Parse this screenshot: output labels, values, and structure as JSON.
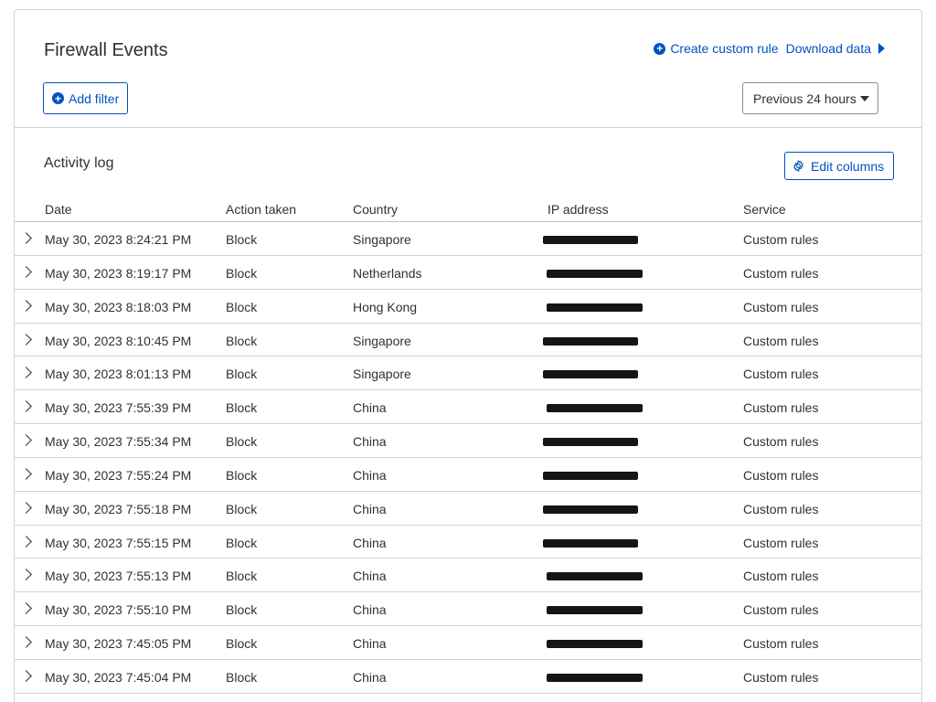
{
  "header": {
    "title": "Firewall Events",
    "create_rule_label": "Create custom rule",
    "download_label": "Download data",
    "add_filter_label": "Add filter",
    "time_range": "Previous 24 hours"
  },
  "activity": {
    "title": "Activity log",
    "edit_columns_label": "Edit columns",
    "columns": [
      "Date",
      "Action taken",
      "Country",
      "IP address",
      "Service"
    ],
    "rows": [
      {
        "date": "May 30, 2023 8:24:21 PM",
        "action": "Block",
        "country": "Singapore",
        "service": "Custom rules"
      },
      {
        "date": "May 30, 2023 8:19:17 PM",
        "action": "Block",
        "country": "Netherlands",
        "service": "Custom rules"
      },
      {
        "date": "May 30, 2023 8:18:03 PM",
        "action": "Block",
        "country": "Hong Kong",
        "service": "Custom rules"
      },
      {
        "date": "May 30, 2023 8:10:45 PM",
        "action": "Block",
        "country": "Singapore",
        "service": "Custom rules"
      },
      {
        "date": "May 30, 2023 8:01:13 PM",
        "action": "Block",
        "country": "Singapore",
        "service": "Custom rules"
      },
      {
        "date": "May 30, 2023 7:55:39 PM",
        "action": "Block",
        "country": "China",
        "service": "Custom rules"
      },
      {
        "date": "May 30, 2023 7:55:34 PM",
        "action": "Block",
        "country": "China",
        "service": "Custom rules"
      },
      {
        "date": "May 30, 2023 7:55:24 PM",
        "action": "Block",
        "country": "China",
        "service": "Custom rules"
      },
      {
        "date": "May 30, 2023 7:55:18 PM",
        "action": "Block",
        "country": "China",
        "service": "Custom rules"
      },
      {
        "date": "May 30, 2023 7:55:15 PM",
        "action": "Block",
        "country": "China",
        "service": "Custom rules"
      },
      {
        "date": "May 30, 2023 7:55:13 PM",
        "action": "Block",
        "country": "China",
        "service": "Custom rules"
      },
      {
        "date": "May 30, 2023 7:55:10 PM",
        "action": "Block",
        "country": "China",
        "service": "Custom rules"
      },
      {
        "date": "May 30, 2023 7:45:05 PM",
        "action": "Block",
        "country": "China",
        "service": "Custom rules"
      },
      {
        "date": "May 30, 2023 7:45:04 PM",
        "action": "Block",
        "country": "China",
        "service": "Custom rules"
      }
    ]
  },
  "colors": {
    "accent": "#0051c3",
    "text": "#313131",
    "border": "#d2d2d2"
  },
  "icons": [
    "plus-circle-icon",
    "caret-right-icon",
    "caret-down-icon",
    "gear-icon",
    "chevron-right-icon"
  ]
}
